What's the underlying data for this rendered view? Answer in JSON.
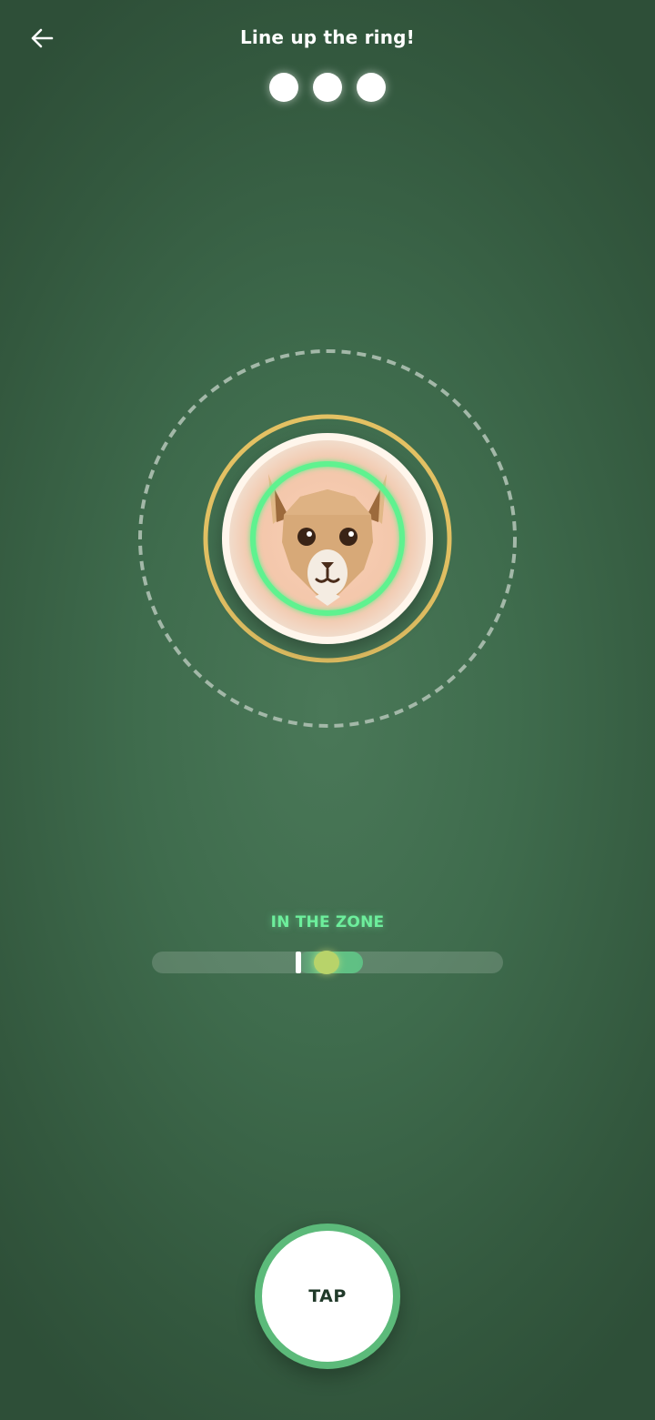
{
  "header": {
    "title": "Line up the ring!",
    "back_icon": "arrow-left-icon"
  },
  "progress": {
    "dots_total": 3,
    "dots_filled": 3
  },
  "target": {
    "character": "llama-face",
    "colors": {
      "outer_guide_ring": "#a3b8a8",
      "gold_ring": "#e3c163",
      "plate": "#fff6ec",
      "plate_inner": "#f4c9ae",
      "aim_ring": "#5ef28f"
    }
  },
  "meter": {
    "status_label": "IN THE ZONE",
    "needle_position": 0.42,
    "zone_start": 0.41,
    "zone_end": 0.6
  },
  "action": {
    "tap_label": "TAP"
  },
  "colors": {
    "background": "#3f6c4d",
    "accent_green": "#5cba7a",
    "zone_text": "#6dee9c"
  }
}
